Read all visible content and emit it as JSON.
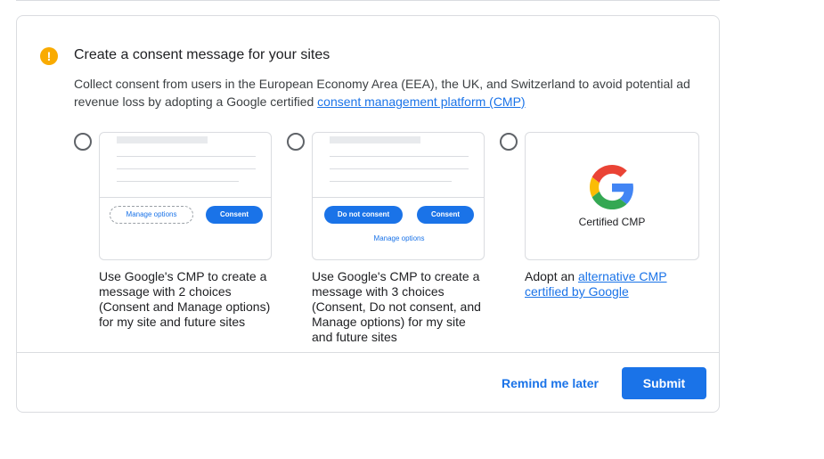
{
  "dialog": {
    "title": "Create a consent message for your sites",
    "warning_icon": "!",
    "description_prefix": "Collect consent from users in the European Economy Area (EEA), the UK, and Switzerland to avoid potential ad revenue loss by adopting a Google certified ",
    "description_link": "consent management platform (CMP)"
  },
  "options": [
    {
      "preview": {
        "manage_button": "Manage options",
        "consent_button": "Consent"
      },
      "text": "Use Google's CMP to create a message with 2 choices (Consent and Manage options) for my site and future sites"
    },
    {
      "preview": {
        "do_not_consent_button": "Do not consent",
        "consent_button": "Consent",
        "manage_link": "Manage options"
      },
      "text": "Use Google's CMP to create a message with 3 choices (Consent, Do not consent, and Manage options) for my site and future sites"
    },
    {
      "preview": {
        "logo_letter": "G",
        "label": "Certified CMP"
      },
      "text_prefix": "Adopt an ",
      "text_link": "alternative CMP certified by Google"
    }
  ],
  "footer": {
    "remind_label": "Remind me later",
    "submit_label": "Submit"
  },
  "colors": {
    "accent": "#1a73e8",
    "warning": "#f9ab00"
  }
}
